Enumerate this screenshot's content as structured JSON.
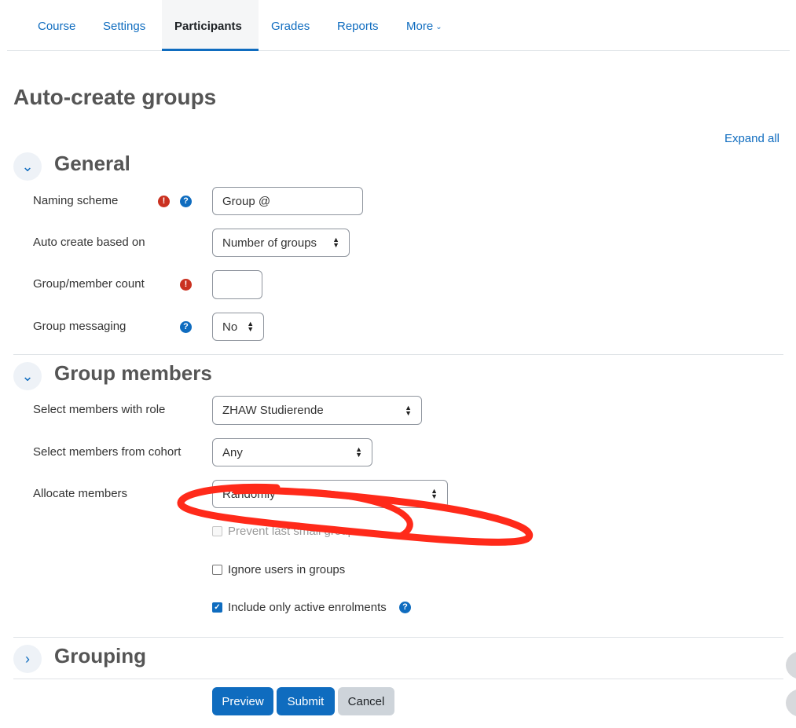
{
  "nav": {
    "tabs": [
      {
        "label": "Course"
      },
      {
        "label": "Settings"
      },
      {
        "label": "Participants"
      },
      {
        "label": "Grades"
      },
      {
        "label": "Reports"
      },
      {
        "label": "More"
      }
    ]
  },
  "page": {
    "title": "Auto-create groups",
    "expand_all": "Expand all"
  },
  "sections": {
    "general": {
      "title": "General",
      "naming_scheme_label": "Naming scheme",
      "naming_scheme_value": "Group @",
      "auto_create_label": "Auto create based on",
      "auto_create_value": "Number of groups",
      "count_label": "Group/member count",
      "count_value": "",
      "messaging_label": "Group messaging",
      "messaging_value": "No"
    },
    "members": {
      "title": "Group members",
      "role_label": "Select members with role",
      "role_value": "ZHAW Studierende",
      "cohort_label": "Select members from cohort",
      "cohort_value": "Any",
      "allocate_label": "Allocate members",
      "allocate_value": "Randomly",
      "prevent_label": "Prevent last small group",
      "prevent_checked": false,
      "ignore_label": "Ignore users in groups",
      "ignore_checked": false,
      "active_label": "Include only active enrolments",
      "active_checked": true
    },
    "grouping": {
      "title": "Grouping"
    }
  },
  "buttons": {
    "preview": "Preview",
    "submit": "Submit",
    "cancel": "Cancel"
  },
  "icons": {
    "required": "exclamation-icon",
    "help": "question-icon",
    "collapse": "chevron-down-icon",
    "expand": "chevron-right-icon"
  },
  "colors": {
    "primary": "#0f6cbf",
    "required": "#ca3120",
    "annotation": "#ff2a1a"
  }
}
